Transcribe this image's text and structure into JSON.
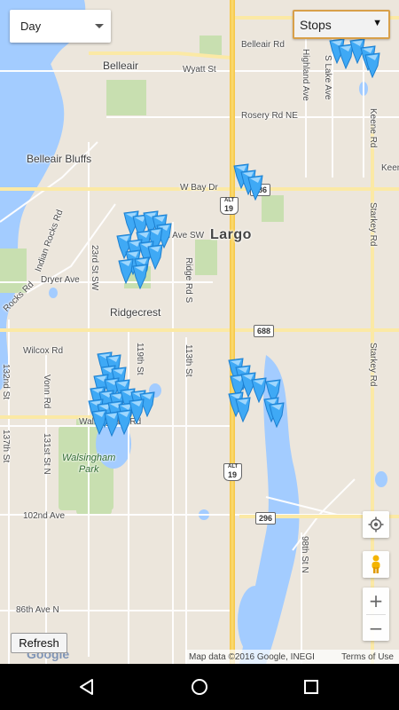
{
  "controls": {
    "day_select": "Day",
    "stops_select": "Stops",
    "stops_arrow": "▼",
    "refresh": "Refresh",
    "zoom_in": "+",
    "zoom_out": "−"
  },
  "map": {
    "places": {
      "belleair": "Belleair",
      "belleair_bluffs": "Belleair Bluffs",
      "largo": "Largo",
      "ridgecrest": "Ridgecrest",
      "walsingham_park": "Walsingham\nPark"
    },
    "roads": {
      "belleair_rd": "Belleair Rd",
      "wyatt_st": "Wyatt St",
      "rosery_rd": "Rosery Rd NE",
      "w_bay_dr": "W Bay Dr",
      "eighth_ave_sw": "8th Ave SW",
      "dryer_ave": "Dryer Ave",
      "wilcox_rd": "Wilcox Rd",
      "walsingham_rd": "Walsingham Rd",
      "second_ave": "102nd Ave",
      "eighty_sixth_ave": "86th Ave N",
      "indian_rocks_rd": "Indian Rocks Rd",
      "rocks_rd": "Rocks Rd",
      "twenty_third_st": "23rd St SW",
      "ridge_rd": "Ridge Rd S",
      "one_nineteen": "119th St",
      "one_thirteen": "113th St",
      "vonn_rd": "Vonn Rd",
      "one_thirty_one": "131st St N",
      "one_thirty_second": "132nd St",
      "one_thirty_seventh": "137th St",
      "highland_ave": "Highland Ave",
      "s_lake_ave": "S Lake Ave",
      "keene_rd": "Keene Rd",
      "keene": "Keen",
      "starkey_rd": "Starkey Rd",
      "ninety_eighth": "98th St N"
    },
    "shields": {
      "alt19_top": "19",
      "alt19_bottom": "19",
      "alt_label": "ALT",
      "r686": "686",
      "r688": "688",
      "r296": "296"
    },
    "pin_color": "#3fa9f5",
    "water_color": "#a3ccff",
    "park_color": "#c8dfb0"
  },
  "attribution": {
    "logo": "Google",
    "text": "Map data ©2016 Google, INEGI",
    "terms": "Terms of Use"
  },
  "navbar": {
    "back": "back-icon",
    "home": "home-icon",
    "recents": "recents-icon"
  }
}
